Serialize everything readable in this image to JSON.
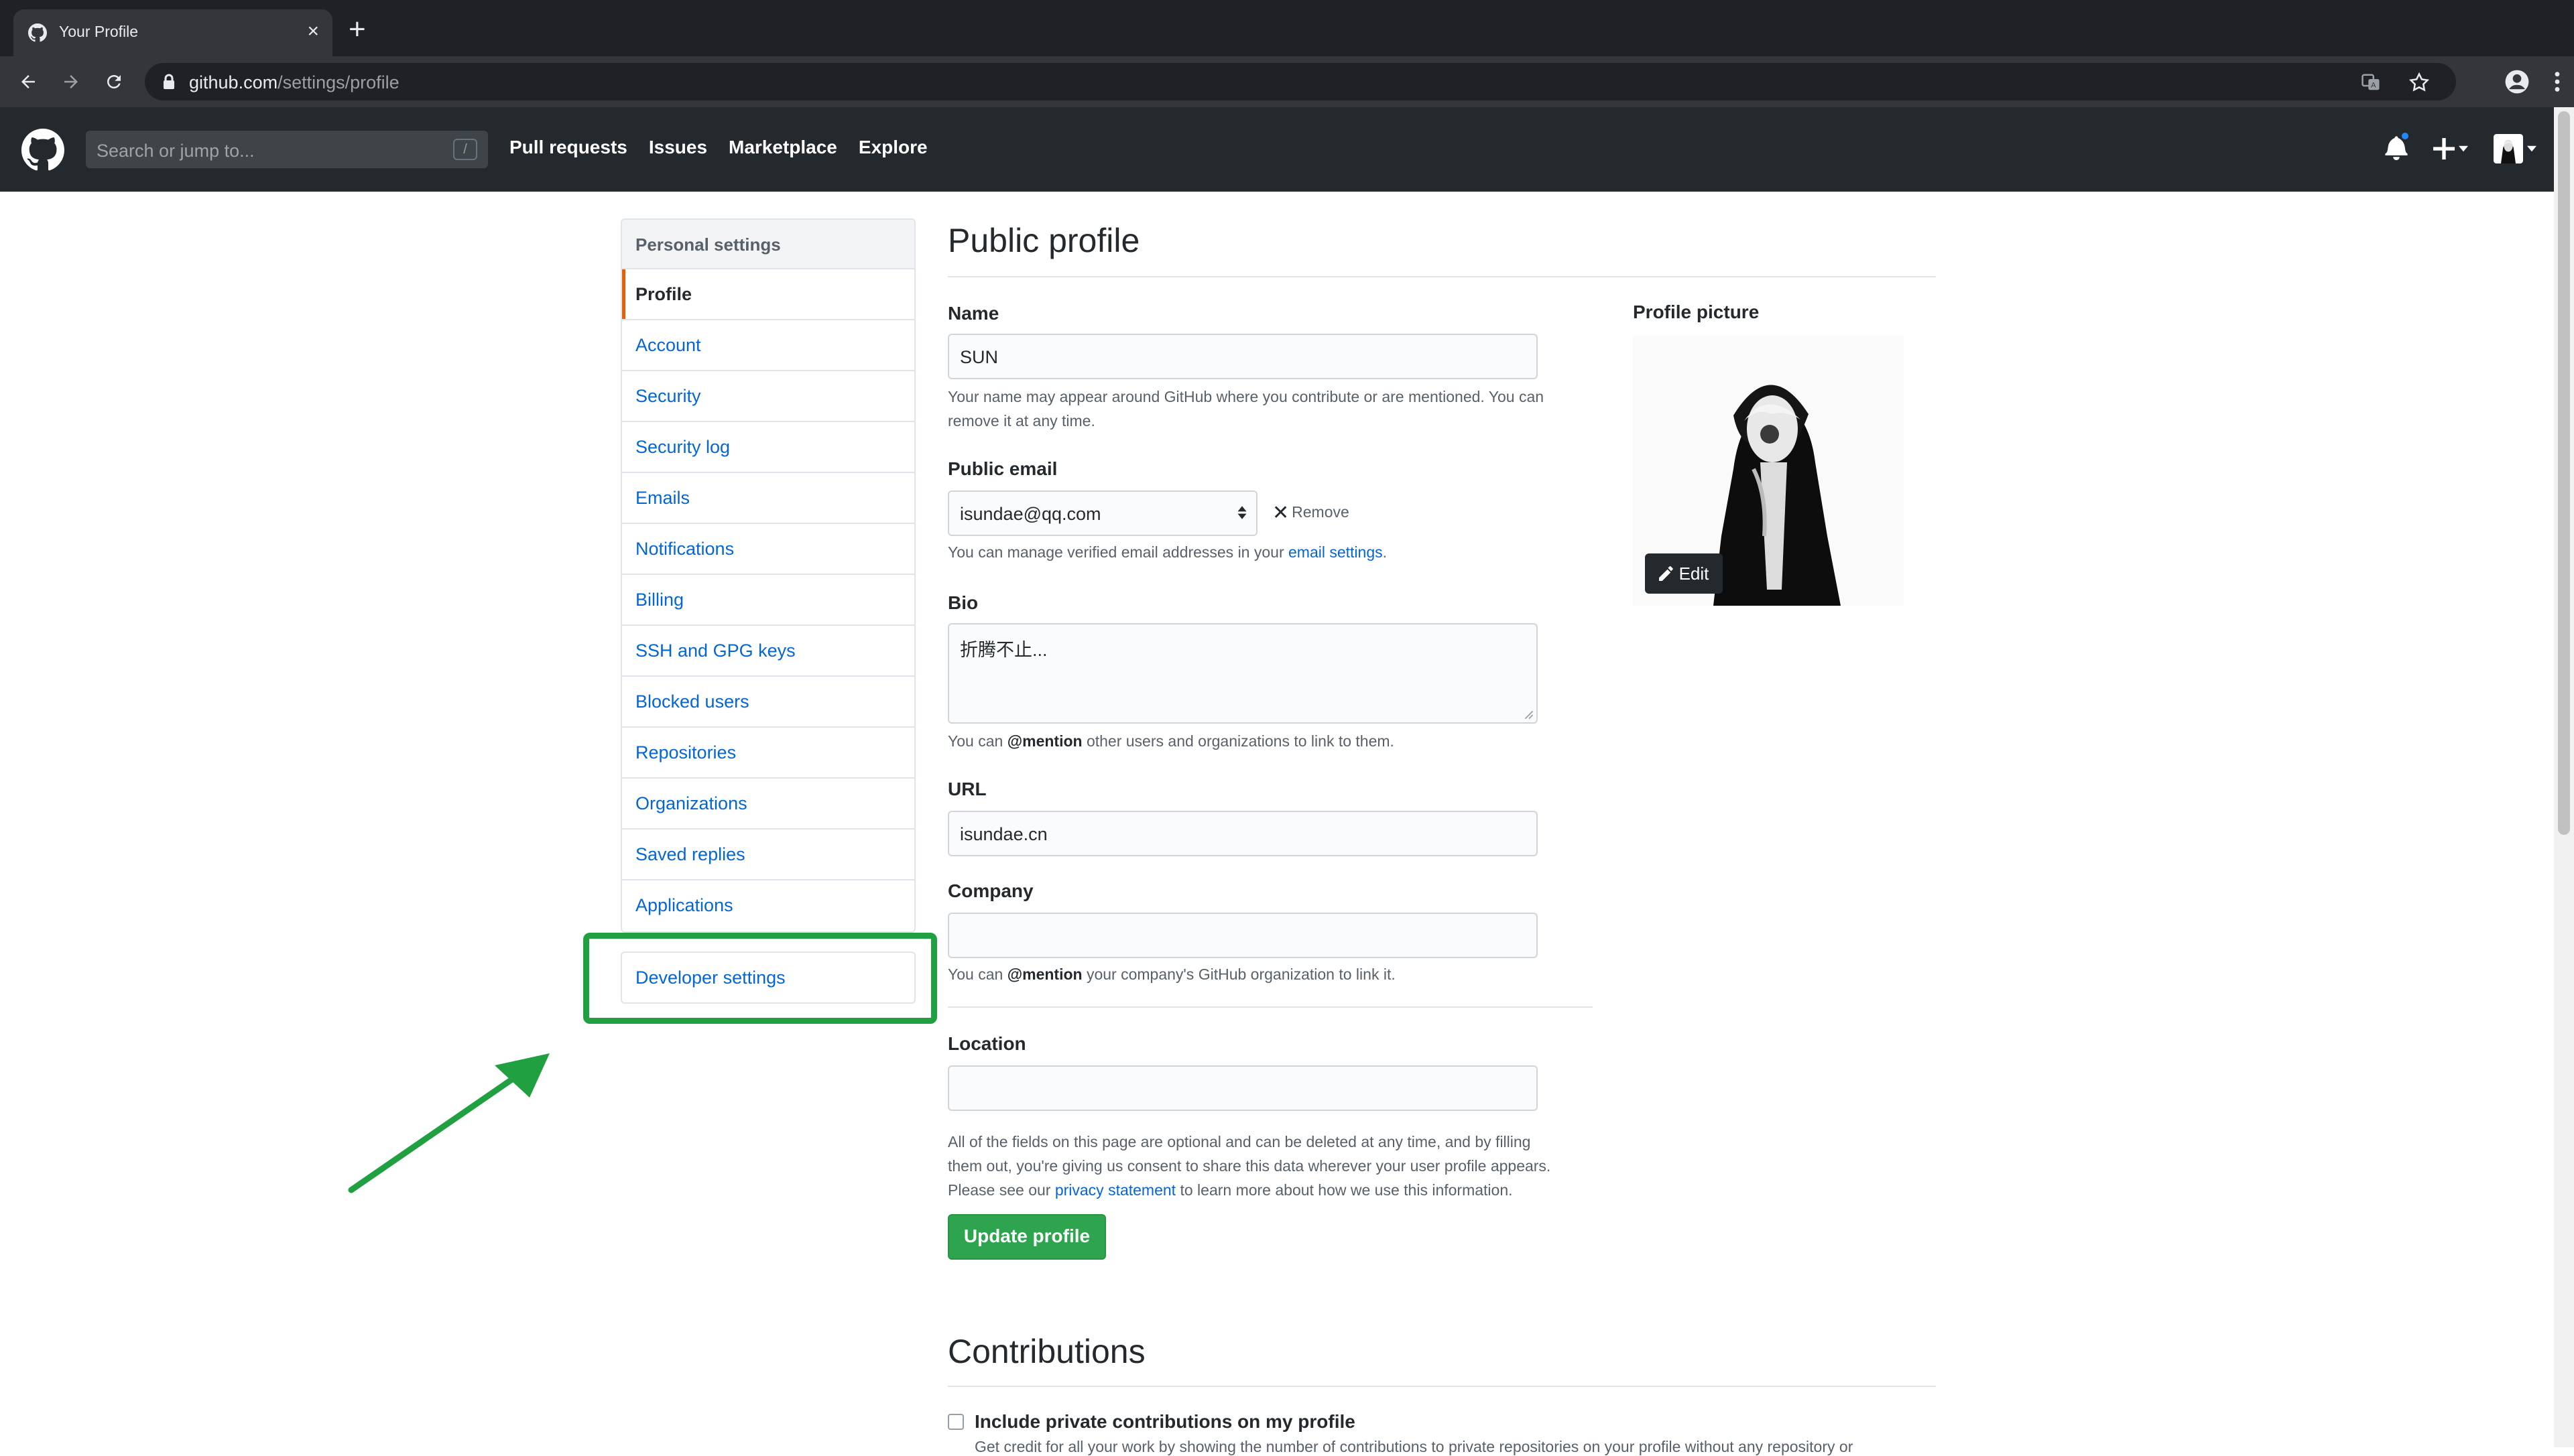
{
  "browser": {
    "tab_title": "Your Profile",
    "tab_close": "×",
    "new_tab": "+",
    "url_host": "github.com",
    "url_path": "/settings/profile"
  },
  "header": {
    "search_placeholder": "Search or jump to...",
    "search_shortcut": "/",
    "nav": [
      "Pull requests",
      "Issues",
      "Marketplace",
      "Explore"
    ]
  },
  "sidebar": {
    "heading": "Personal settings",
    "items": [
      {
        "label": "Profile",
        "selected": true
      },
      {
        "label": "Account"
      },
      {
        "label": "Security"
      },
      {
        "label": "Security log"
      },
      {
        "label": "Emails"
      },
      {
        "label": "Notifications"
      },
      {
        "label": "Billing"
      },
      {
        "label": "SSH and GPG keys"
      },
      {
        "label": "Blocked users"
      },
      {
        "label": "Repositories"
      },
      {
        "label": "Organizations"
      },
      {
        "label": "Saved replies"
      },
      {
        "label": "Applications"
      }
    ],
    "developer_settings": "Developer settings"
  },
  "main": {
    "title": "Public profile",
    "name": {
      "label": "Name",
      "value": "SUN",
      "note_line1": "Your name may appear around GitHub where you contribute or are mentioned. You can",
      "note_line2": "remove it at any time."
    },
    "email": {
      "label": "Public email",
      "value": "isundae@qq.com",
      "remove": "Remove",
      "note_pre": "You can manage verified email addresses in your ",
      "note_link": "email settings",
      "note_post": "."
    },
    "bio": {
      "label": "Bio",
      "value": "折腾不止...",
      "note_pre": "You can ",
      "note_mention": "@mention",
      "note_post": " other users and organizations to link to them."
    },
    "url": {
      "label": "URL",
      "value": "isundae.cn"
    },
    "company": {
      "label": "Company",
      "value": "",
      "note_pre": "You can ",
      "note_mention": "@mention",
      "note_post": " your company's GitHub organization to link it."
    },
    "location": {
      "label": "Location",
      "value": ""
    },
    "disclaimer_line1": "All of the fields on this page are optional and can be deleted at any time, and by filling",
    "disclaimer_line2": "them out, you're giving us consent to share this data wherever your user profile appears.",
    "disclaimer_line3_pre": "Please see our ",
    "disclaimer_link": "privacy statement",
    "disclaimer_line3_post": " to learn more about how we use this information.",
    "update_button": "Update profile",
    "picture_label": "Profile picture",
    "edit_button": "Edit",
    "contributions_title": "Contributions",
    "private_contrib_label": "Include private contributions on my profile",
    "private_contrib_note": "Get credit for all your work by showing the number of contributions to private repositories on your profile without any repository or"
  },
  "colors": {
    "header_bg": "#24292e",
    "link": "#0366d6",
    "primary_button": "#2ea44f",
    "selected_accent": "#e36209",
    "annotation": "#20a040"
  }
}
